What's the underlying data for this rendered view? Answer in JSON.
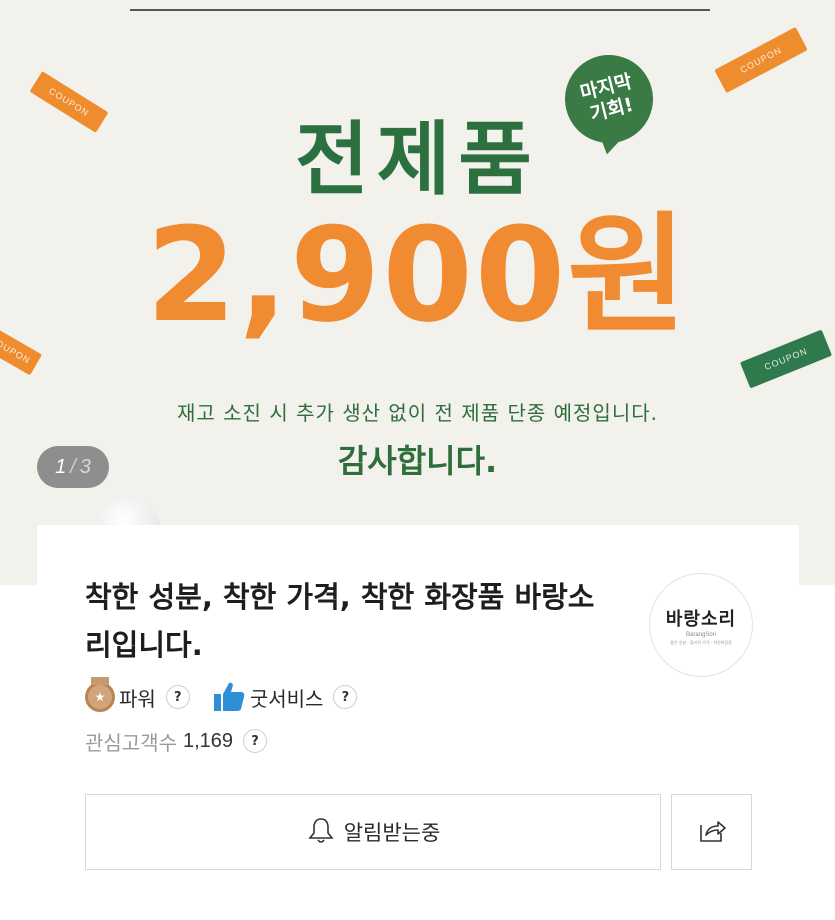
{
  "banner": {
    "coupon_text": "COUPON",
    "badge_text": "마지막\n기회!",
    "headline": "전제품",
    "price": "2,900원",
    "notice": "재고 소진 시 추가 생산 없이 전 제품 단종 예정입니다.",
    "thanks": "감사합니다.",
    "pager": {
      "current": "1",
      "separator": "/",
      "total": "3"
    },
    "colors": {
      "green": "#2d7040",
      "orange": "#f08b32",
      "background": "#f2f1ec"
    }
  },
  "store": {
    "title": "착한 성분, 착한 가격, 착한 화장품 바랑소리입니다.",
    "logo": {
      "korean": "바랑소리",
      "english": "BarangSori",
      "slogan": "좋은 성분 · 합리적 가격 · 착한화장품"
    },
    "badges": [
      {
        "icon": "medal-icon",
        "label": "파워",
        "help": "?"
      },
      {
        "icon": "thumbs-up-icon",
        "label": "굿서비스",
        "help": "?"
      }
    ],
    "followers": {
      "label": "관심고객수",
      "count": "1,169",
      "help": "?"
    },
    "alarm_button": {
      "icon": "bell-icon",
      "label": "알림받는중"
    },
    "share_button": {
      "icon": "share-icon"
    }
  }
}
